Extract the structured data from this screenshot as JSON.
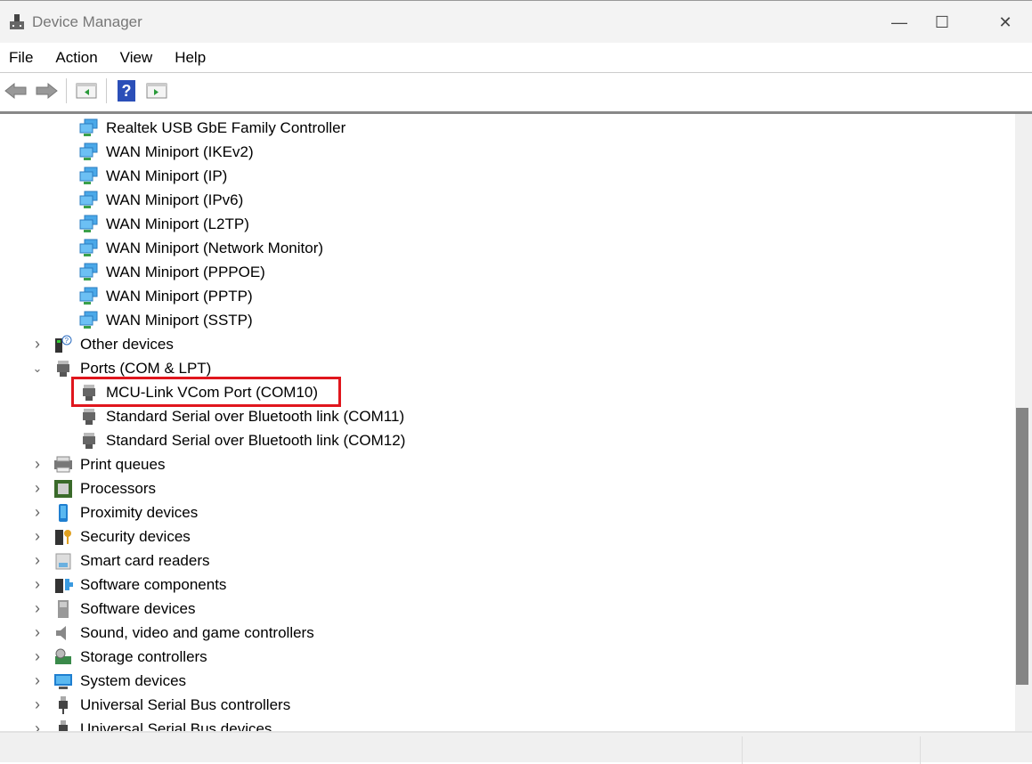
{
  "window": {
    "title": "Device Manager",
    "minimize": "—",
    "maximize": "☐",
    "close": "✕"
  },
  "menu": [
    "File",
    "Action",
    "View",
    "Help"
  ],
  "toolbar": {
    "back": "back-icon",
    "forward": "forward-icon",
    "show_hide_console": "console-tree-icon",
    "help": "?",
    "action_pane": "action-pane-icon"
  },
  "tree": [
    {
      "label": "Realtek USB GbE Family Controller",
      "level": 2,
      "icon": "network"
    },
    {
      "label": "WAN Miniport (IKEv2)",
      "level": 2,
      "icon": "network"
    },
    {
      "label": "WAN Miniport (IP)",
      "level": 2,
      "icon": "network"
    },
    {
      "label": "WAN Miniport (IPv6)",
      "level": 2,
      "icon": "network"
    },
    {
      "label": "WAN Miniport (L2TP)",
      "level": 2,
      "icon": "network"
    },
    {
      "label": "WAN Miniport (Network Monitor)",
      "level": 2,
      "icon": "network"
    },
    {
      "label": "WAN Miniport (PPPOE)",
      "level": 2,
      "icon": "network"
    },
    {
      "label": "WAN Miniport (PPTP)",
      "level": 2,
      "icon": "network"
    },
    {
      "label": "WAN Miniport (SSTP)",
      "level": 2,
      "icon": "network"
    },
    {
      "label": "Other devices",
      "level": 1,
      "icon": "other",
      "expanded": false
    },
    {
      "label": "Ports (COM & LPT)",
      "level": 1,
      "icon": "port",
      "expanded": true
    },
    {
      "label": "MCU-Link VCom Port (COM10)",
      "level": 2,
      "icon": "port",
      "highlighted": true
    },
    {
      "label": "Standard Serial over Bluetooth link (COM11)",
      "level": 2,
      "icon": "port"
    },
    {
      "label": "Standard Serial over Bluetooth link (COM12)",
      "level": 2,
      "icon": "port"
    },
    {
      "label": "Print queues",
      "level": 1,
      "icon": "printer",
      "expanded": false
    },
    {
      "label": "Processors",
      "level": 1,
      "icon": "processor",
      "expanded": false
    },
    {
      "label": "Proximity devices",
      "level": 1,
      "icon": "proximity",
      "expanded": false
    },
    {
      "label": "Security devices",
      "level": 1,
      "icon": "security",
      "expanded": false
    },
    {
      "label": "Smart card readers",
      "level": 1,
      "icon": "smartcard",
      "expanded": false
    },
    {
      "label": "Software components",
      "level": 1,
      "icon": "software-component",
      "expanded": false
    },
    {
      "label": "Software devices",
      "level": 1,
      "icon": "software-device",
      "expanded": false
    },
    {
      "label": "Sound, video and game controllers",
      "level": 1,
      "icon": "sound",
      "expanded": false
    },
    {
      "label": "Storage controllers",
      "level": 1,
      "icon": "storage",
      "expanded": false
    },
    {
      "label": "System devices",
      "level": 1,
      "icon": "system",
      "expanded": false
    },
    {
      "label": "Universal Serial Bus controllers",
      "level": 1,
      "icon": "usb",
      "expanded": false
    },
    {
      "label": "Universal Serial Bus devices",
      "level": 1,
      "icon": "usb",
      "expanded": false
    }
  ],
  "colors": {
    "highlight": "#e0161d"
  }
}
